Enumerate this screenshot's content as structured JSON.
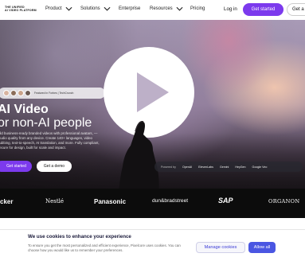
{
  "nav": {
    "logo_line1": "THE UNIFIED",
    "logo_line2": "AI VIDEO PLATFORM",
    "items": [
      {
        "label": "Product"
      },
      {
        "label": "Solutions"
      },
      {
        "label": "Enterprise"
      },
      {
        "label": "Resources"
      },
      {
        "label": "Pricing"
      }
    ],
    "login": "Log in",
    "get_started": "Get started",
    "get_demo": "Get a d"
  },
  "hero": {
    "pill_text": "Featured in Forbes | TechCrunch",
    "headline_line1": "AI Video",
    "headline_line2": "or non-AI people",
    "description": "uild business-ready branded videos with professional avatars, — studio quality from any device. Create 140+ languages, video dubbing, text-to-speech, AI translation, and more. Fully compliant, secure for design, built for scale and impact.",
    "btn_get_started": "Get started",
    "btn_get_demo": "Get a demo",
    "powered_by": {
      "label": "Powered by",
      "partners": [
        "OpenAI",
        "ElevenLabs",
        "Gemini",
        "HeyGen",
        "Google Veo"
      ]
    }
  },
  "brands": [
    "cker",
    "Nestlé",
    "Panasonic",
    "dun&bradstreet",
    "SAP",
    "ORGANON"
  ],
  "cookie": {
    "title": "We use cookies to enhance your experience",
    "text": "To ensure you get the most personalized and efficient experience, Pixelcore uses cookies. You can choose how you would like us to remember your preferences.",
    "manage": "Manage cookies",
    "allow": "Allow all"
  },
  "colors": {
    "accent": "#7c3aed",
    "cookie_allow": "#4a56e2",
    "band": "#0c0c0c"
  }
}
